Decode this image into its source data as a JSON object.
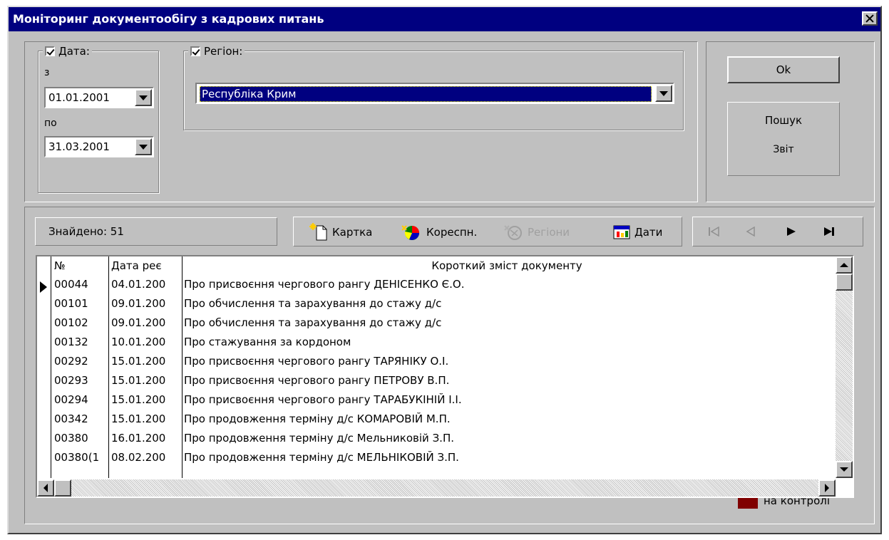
{
  "window": {
    "title": "Моніторинг документообігу з кадрових питань"
  },
  "filters": {
    "date": {
      "label": "Дата:",
      "from_label": "з",
      "from_value": "01.01.2001",
      "to_label": "по",
      "to_value": "31.03.2001"
    },
    "region": {
      "label": "Регіон:",
      "value": "Республіка Крим"
    }
  },
  "actions": {
    "ok": "Ok",
    "search": "Пошук",
    "report": "Звіт"
  },
  "status": {
    "found": "Знайдено: 51"
  },
  "toolbar": {
    "card": "Картка",
    "corresp": "Кореспн.",
    "regions": "Регіони",
    "dates": "Дати"
  },
  "table": {
    "columns": [
      "№",
      "Дата реє",
      "Короткий зміст документу"
    ],
    "rows": [
      [
        "00044",
        "04.01.200",
        "Про присвоєння чергового рангу ДЕНІСЕНКО Є.О."
      ],
      [
        "00101",
        "09.01.200",
        "Про обчислення та зарахування до стажу д/с"
      ],
      [
        "00102",
        "09.01.200",
        "Про обчислення та зарахування до стажу д/с"
      ],
      [
        "00132",
        "10.01.200",
        "Про стажування за кордоном"
      ],
      [
        "00292",
        "15.01.200",
        "Про присвоєння чергового рангу ТАРЯНІКУ О.І."
      ],
      [
        "00293",
        "15.01.200",
        "Про присвоєння чергового рангу ПЕТРОВУ В.П."
      ],
      [
        "00294",
        "15.01.200",
        "Про присвоєння чергового рангу ТАРАБУКІНІЙ І.І."
      ],
      [
        "00342",
        "15.01.200",
        "Про продовження терміну д/с КОМАРОВІЙ М.П."
      ],
      [
        "00380",
        "16.01.200",
        "Про продовження терміну д/с Мельниковій З.П."
      ],
      [
        "00380(1",
        "08.02.200",
        "Про продовження терміну д/с МЕЛЬНІКОВІЙ З.П."
      ]
    ]
  },
  "legend": {
    "label": "на контролі",
    "color": "#800000"
  }
}
